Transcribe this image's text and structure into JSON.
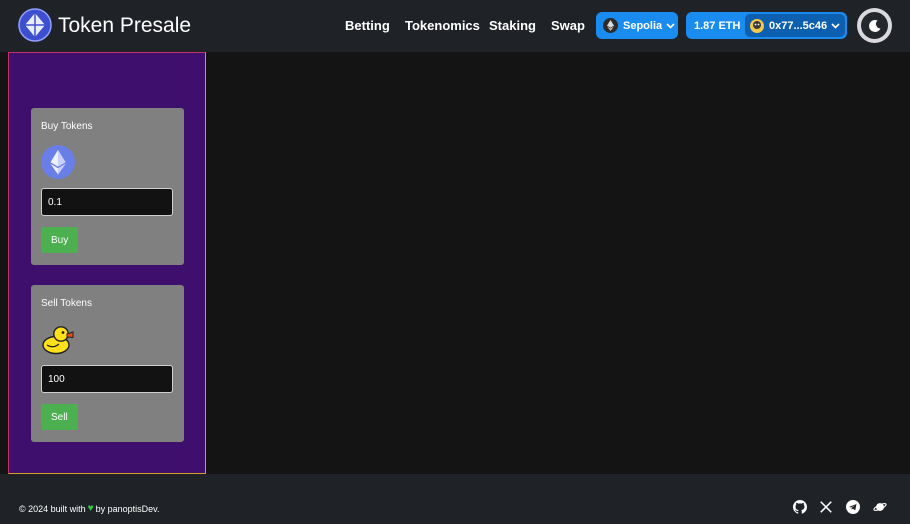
{
  "header": {
    "brand": "Token Presale",
    "nav": [
      "Betting",
      "Tokenomics",
      "Staking",
      "Swap"
    ],
    "network": "Sepolia",
    "balance": "1.87 ETH",
    "address": "0x77...5c46"
  },
  "buy_card": {
    "title": "Buy Tokens",
    "icon": "ethereum-icon",
    "amount": "0.1",
    "button": "Buy"
  },
  "sell_card": {
    "title": "Sell Tokens",
    "icon": "duck-icon",
    "amount": "100",
    "button": "Sell"
  },
  "footer": {
    "prefix": "© 2024 built with",
    "suffix": "by panoptisDev.",
    "socials": [
      "github-icon",
      "x-icon",
      "telegram-icon",
      "planet-icon"
    ]
  },
  "colors": {
    "header_bg": "#1f2227",
    "panel_bg": "#3e0f6d",
    "accent_blue": "#1a8cf0",
    "button_green": "#4caf50"
  }
}
